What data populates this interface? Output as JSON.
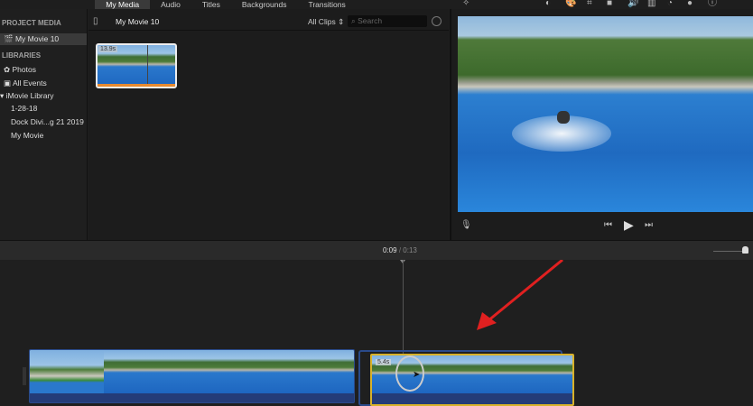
{
  "tabs": [
    "My Media",
    "Audio",
    "Titles",
    "Backgrounds",
    "Transitions"
  ],
  "sidebar": {
    "project_header": "PROJECT MEDIA",
    "project_item": "My Movie 10",
    "libraries_header": "LIBRARIES",
    "items": [
      "Photos",
      "All Events"
    ],
    "library": "iMovie Library",
    "events": [
      "1-28-18",
      "Dock Divi...g 21 2019",
      "My Movie"
    ]
  },
  "browser": {
    "title": "My Movie 10",
    "filter": "All Clips",
    "search_placeholder": "Search",
    "clip_duration": "13.9s"
  },
  "viewer_tools": [
    "magic-wand",
    "color-balance",
    "color-correction",
    "crop",
    "stabilization",
    "volume",
    "noise-reduction",
    "speed",
    "clip-filter",
    "info"
  ],
  "timeline": {
    "current_time": "0:09",
    "separator": "/",
    "total_time": "0:13",
    "selected_clip_duration": "5.4s"
  },
  "colors": {
    "selection": "#d8b22a",
    "arrow": "#e02020",
    "audio": "#243c78",
    "clip_border": "#2a4a8a"
  }
}
